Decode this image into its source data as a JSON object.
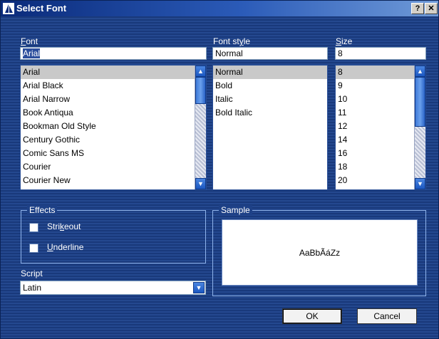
{
  "window": {
    "title": "Select Font",
    "help_label": "?",
    "close_label": "✕"
  },
  "font": {
    "label_pre": "",
    "label_u": "F",
    "label_post": "ont",
    "value": "Arial",
    "items": [
      "Arial",
      "Arial Black",
      "Arial Narrow",
      "Book Antiqua",
      "Bookman Old Style",
      "Century Gothic",
      "Comic Sans MS",
      "Courier",
      "Courier New"
    ],
    "selected": "Arial"
  },
  "style": {
    "label_pre": "Font st",
    "label_u": "y",
    "label_post": "le",
    "value": "Normal",
    "items": [
      "Normal",
      "Bold",
      "Italic",
      "Bold Italic"
    ],
    "selected": "Normal"
  },
  "size": {
    "label_pre": "",
    "label_u": "S",
    "label_post": "ize",
    "value": "8",
    "items": [
      "8",
      "9",
      "10",
      "11",
      "12",
      "14",
      "16",
      "18",
      "20"
    ],
    "selected": "8"
  },
  "effects": {
    "title": "Effects",
    "strikeout": {
      "pre": "Stri",
      "u": "k",
      "post": "eout",
      "checked": false
    },
    "underline": {
      "pre": "",
      "u": "U",
      "post": "nderline",
      "checked": false
    }
  },
  "sample": {
    "title": "Sample",
    "text": "AaBbÃáZz"
  },
  "script": {
    "label": "Script",
    "value": "Latin"
  },
  "buttons": {
    "ok": "OK",
    "cancel": "Cancel"
  },
  "icons": {
    "app": "sail-logo-icon",
    "scroll_up": "arrow-up-icon",
    "scroll_down": "arrow-down-icon",
    "dropdown": "chevron-down-icon"
  },
  "colors": {
    "background": "#1d3f84",
    "titlebar": "#0a2a7a",
    "scroll_button": "#1b57c1",
    "list_selection": "#c9c9c9"
  }
}
